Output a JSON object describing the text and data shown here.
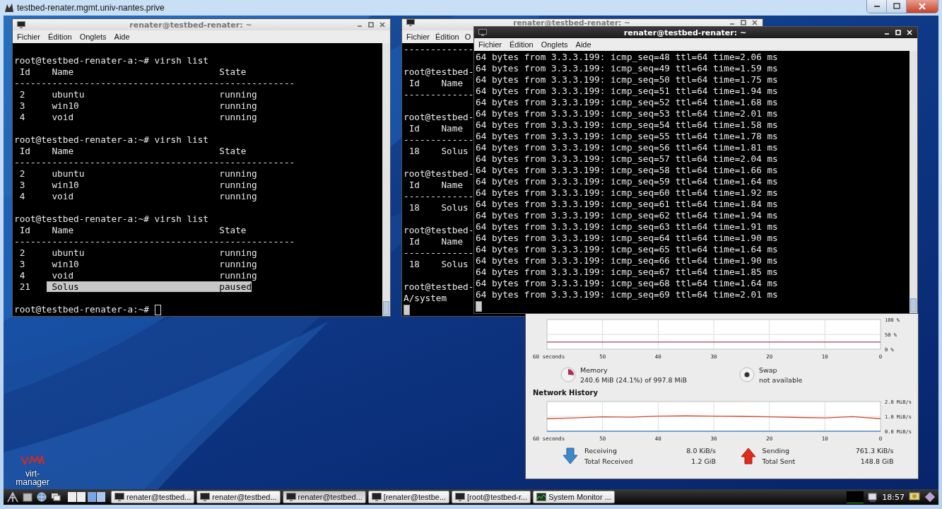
{
  "host_window": {
    "title": "testbed-renater.mgmt.univ-nantes.prive"
  },
  "desktop_icons": [
    {
      "label": "virt-manager"
    }
  ],
  "terminals": [
    {
      "title": "renater@testbed-renater: ~",
      "active": false,
      "menu": [
        "Fichier",
        "Édition",
        "Onglets",
        "Aide"
      ],
      "cursor": true,
      "blocks": [
        [
          "root@testbed-renater-a:~# virsh list",
          " Id    Name                           State",
          "----------------------------------------------------",
          " 2     ubuntu                         running",
          " 3     win10                          running",
          " 4     void                           running"
        ],
        [
          "root@testbed-renater-a:~# virsh list",
          " Id    Name                           State",
          "----------------------------------------------------",
          " 2     ubuntu                         running",
          " 3     win10                          running",
          " 4     void                           running"
        ],
        [
          "root@testbed-renater-a:~# virsh list",
          " Id    Name                           State",
          "----------------------------------------------------",
          " 2     ubuntu                         running",
          " 3     win10                          running",
          " 4     void                           running",
          {
            "text": " 21   ",
            "selection": " Solus                          paused"
          }
        ],
        [
          "root@testbed-renater-a:~# "
        ]
      ]
    },
    {
      "title": "renater@testbed-renater: ~",
      "active": false,
      "menu": [
        "Fichier",
        "Édition",
        "O"
      ],
      "cursor": true,
      "blocks": [
        [
          "-------------"
        ],
        [
          "root@testbed-",
          " Id    Name",
          "-------------"
        ],
        [
          "root@testbed-",
          " Id    Name",
          "-------------",
          " 18    Solus"
        ],
        [
          "root@testbed-",
          " Id    Name",
          "-------------",
          " 18    Solus"
        ],
        [
          "root@testbed-",
          " Id    Name",
          "-------------",
          " 18    Solus"
        ],
        [
          "root@testbed-",
          "A/system"
        ]
      ]
    },
    {
      "title": "renater@testbed-renater: ~",
      "active": true,
      "menu": [
        "Fichier",
        "Édition",
        "Onglets",
        "Aide"
      ],
      "cursor": true,
      "blocks": [
        [
          "64 bytes from 3.3.3.199: icmp_seq=48 ttl=64 time=2.06 ms",
          "64 bytes from 3.3.3.199: icmp_seq=49 ttl=64 time=1.59 ms",
          "64 bytes from 3.3.3.199: icmp_seq=50 ttl=64 time=1.75 ms",
          "64 bytes from 3.3.3.199: icmp_seq=51 ttl=64 time=1.94 ms",
          "64 bytes from 3.3.3.199: icmp_seq=52 ttl=64 time=1.68 ms",
          "64 bytes from 3.3.3.199: icmp_seq=53 ttl=64 time=2.01 ms",
          "64 bytes from 3.3.3.199: icmp_seq=54 ttl=64 time=1.58 ms",
          "64 bytes from 3.3.3.199: icmp_seq=55 ttl=64 time=1.78 ms",
          "64 bytes from 3.3.3.199: icmp_seq=56 ttl=64 time=1.81 ms",
          "64 bytes from 3.3.3.199: icmp_seq=57 ttl=64 time=2.04 ms",
          "64 bytes from 3.3.3.199: icmp_seq=58 ttl=64 time=1.66 ms",
          "64 bytes from 3.3.3.199: icmp_seq=59 ttl=64 time=1.64 ms",
          "64 bytes from 3.3.3.199: icmp_seq=60 ttl=64 time=1.92 ms",
          "64 bytes from 3.3.3.199: icmp_seq=61 ttl=64 time=1.84 ms",
          "64 bytes from 3.3.3.199: icmp_seq=62 ttl=64 time=1.94 ms",
          "64 bytes from 3.3.3.199: icmp_seq=63 ttl=64 time=1.91 ms",
          "64 bytes from 3.3.3.199: icmp_seq=64 ttl=64 time=1.90 ms",
          "64 bytes from 3.3.3.199: icmp_seq=65 ttl=64 time=1.64 ms",
          "64 bytes from 3.3.3.199: icmp_seq=66 ttl=64 time=1.90 ms",
          "64 bytes from 3.3.3.199: icmp_seq=67 ttl=64 time=1.85 ms",
          "64 bytes from 3.3.3.199: icmp_seq=68 ttl=64 time=1.64 ms",
          "64 bytes from 3.3.3.199: icmp_seq=69 ttl=64 time=2.01 ms"
        ]
      ]
    }
  ],
  "system_monitor": {
    "history_chart": {
      "chart_data": {
        "type": "line",
        "grid": true,
        "x": [
          60,
          0
        ],
        "xlim": [
          60,
          0
        ],
        "ylim": [
          0,
          100
        ],
        "xticks": [
          {
            "value": 60,
            "label": "60 seconds"
          },
          {
            "value": 50,
            "label": "50"
          },
          {
            "value": 40,
            "label": "40"
          },
          {
            "value": 30,
            "label": "30"
          },
          {
            "value": 20,
            "label": "20"
          },
          {
            "value": 10,
            "label": "10"
          },
          {
            "value": 0,
            "label": "0"
          }
        ],
        "yticks": [
          {
            "value": 0,
            "label": "0 %"
          },
          {
            "value": 50,
            "label": "50 %"
          },
          {
            "value": 100,
            "label": "100 %"
          }
        ],
        "series": [
          {
            "color": "#a8406a",
            "values": [
              24.1,
              24.1
            ]
          }
        ]
      }
    },
    "memory": {
      "label": "Memory",
      "value": "240.6 MiB (24.1%) of 997.8 MiB"
    },
    "swap": {
      "label": "Swap",
      "value": "not available"
    },
    "network_title": "Network History",
    "network_chart": {
      "chart_data": {
        "type": "line",
        "grid": true,
        "x": [
          60,
          55,
          50,
          45,
          40,
          35,
          30,
          25,
          20,
          15,
          10,
          5,
          0
        ],
        "xlim": [
          60,
          0
        ],
        "ylim": [
          0,
          2
        ],
        "xticks": [
          {
            "value": 60,
            "label": "60 seconds"
          },
          {
            "value": 50,
            "label": "50"
          },
          {
            "value": 40,
            "label": "40"
          },
          {
            "value": 30,
            "label": "30"
          },
          {
            "value": 20,
            "label": "20"
          },
          {
            "value": 10,
            "label": "10"
          },
          {
            "value": 0,
            "label": "0"
          }
        ],
        "yticks": [
          {
            "value": 0,
            "label": "0.0 MiB/s"
          },
          {
            "value": 1,
            "label": "1.0 MiB/s"
          },
          {
            "value": 2,
            "label": "2.0 MiB/s"
          }
        ],
        "series": [
          {
            "color": "#5a8ec8",
            "values": [
              0,
              0,
              0,
              0,
              0,
              0,
              0,
              0,
              0,
              0,
              0,
              0,
              0
            ]
          },
          {
            "color": "#d0503a",
            "values": [
              0.85,
              0.9,
              0.97,
              0.95,
              1.02,
              1.04,
              1.02,
              1.0,
              0.97,
              0.93,
              0.9,
              0.98,
              0.85
            ]
          }
        ]
      }
    },
    "traffic": [
      {
        "kind": "receive",
        "label": "Receiving",
        "rate": "8.0 KiB/s",
        "total_label": "Total Received",
        "total": "1.2 GiB"
      },
      {
        "kind": "send",
        "label": "Sending",
        "rate": "761.3 KiB/s",
        "total_label": "Total Sent",
        "total": "148.8 GiB"
      }
    ]
  },
  "taskbar": {
    "tasks": [
      {
        "label": "renater@testbed...",
        "selected": false
      },
      {
        "label": "renater@testbed...",
        "selected": false
      },
      {
        "label": "renater@testbed...",
        "selected": true
      },
      {
        "label": "[renater@testbe...",
        "selected": false
      },
      {
        "label": "[root@testbed-r...",
        "selected": false
      },
      {
        "label": "System Monitor ...",
        "selected": false,
        "kind": "monitor"
      }
    ],
    "clock": "18:57"
  }
}
